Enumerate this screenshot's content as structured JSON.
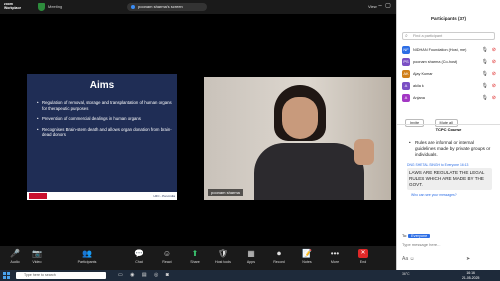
{
  "app": {
    "brand": "zoom\nWorkplace",
    "meeting_label": "Meeting",
    "screen_share_pill": "poonam sharma's screen",
    "view_label": "View"
  },
  "slide": {
    "title": "Aims",
    "bullets": [
      "Regulation of removal, storage and transplantation of human organs for therapeutic purposes",
      "Prevention of commercial dealings in human organs",
      "Recognises Brain-stem death and allows organ donation from brain-dead donors"
    ],
    "footer_tag": "LRC - Pan-India"
  },
  "video": {
    "name_label": "poonam sharma"
  },
  "toolbar": {
    "items": [
      {
        "label": "Audio",
        "icon": "mic-icon"
      },
      {
        "label": "Video",
        "icon": "video-off-icon"
      },
      {
        "label": "Participants",
        "icon": "participants-icon",
        "count": "37"
      },
      {
        "label": "Chat",
        "icon": "chat-icon"
      },
      {
        "label": "React",
        "icon": "react-icon"
      },
      {
        "label": "Share",
        "icon": "share-icon"
      },
      {
        "label": "Host tools",
        "icon": "host-tools-icon"
      },
      {
        "label": "Apps",
        "icon": "apps-icon"
      },
      {
        "label": "Record",
        "icon": "record-icon"
      },
      {
        "label": "Notes",
        "icon": "notes-icon"
      },
      {
        "label": "More",
        "icon": "more-icon"
      },
      {
        "label": "End",
        "icon": "end-icon"
      }
    ]
  },
  "participants": {
    "header": "Participants (37)",
    "search_placeholder": "Find a participant",
    "list": [
      {
        "initials": "NF",
        "name": "NIDHAN Foundation (Host, me)",
        "color": "#2d6ee5"
      },
      {
        "initials": "PS",
        "name": "poonam sharma (Co-host)",
        "color": "#7a4fc4"
      },
      {
        "initials": "AK",
        "name": "Ajay Kumar",
        "color": "#d07f1a"
      },
      {
        "initials": "A",
        "name": "akila k",
        "color": "#7a4fc4"
      },
      {
        "initials": "A",
        "name": "Anjana",
        "color": "#a338c4"
      }
    ],
    "invite_label": "Invite",
    "mute_all_label": "Mute all"
  },
  "chat": {
    "header": "TCPC Course",
    "message1": "Rules are informal or internal guidelines made by private groups or individuals.",
    "sender2": "DNG SHETAL SINGH to Everyone 16:13",
    "message2": "LAWS ARE REGULATE THE LEGAL RULES WHICH ARE MADE BY THE GOVT.",
    "who_can_see": "Who can see your messages?",
    "to_label": "To:",
    "to_value": "Everyone",
    "input_placeholder": "Type message here..."
  },
  "taskbar": {
    "search_placeholder": "Type here to search",
    "weather": "36°C",
    "time": "16:16",
    "date": "21-05-2025"
  }
}
